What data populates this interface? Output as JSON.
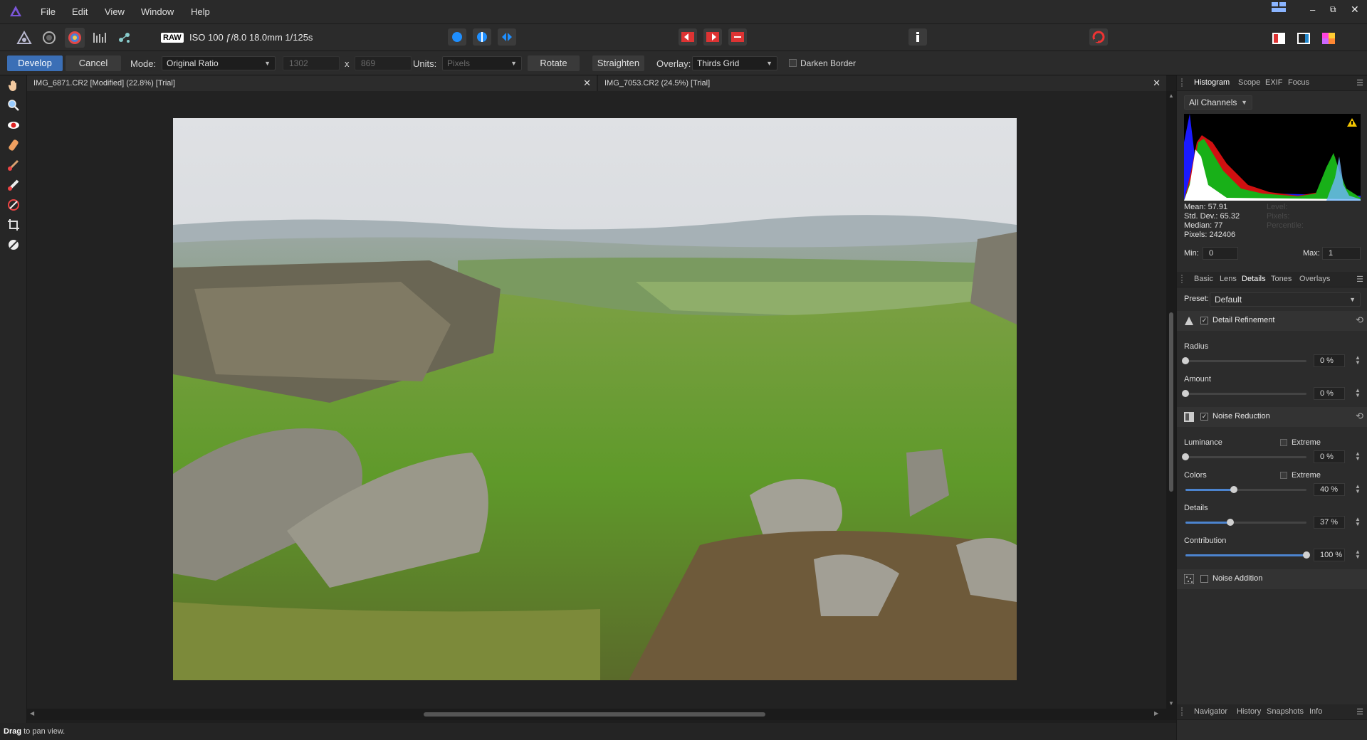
{
  "menubar": {
    "items": [
      "File",
      "Edit",
      "View",
      "Window",
      "Help"
    ]
  },
  "toolbar": {
    "raw_badge": "RAW",
    "exif_summary": "ISO 100 ƒ/8.0 18.0mm 1/125s"
  },
  "context": {
    "develop": "Develop",
    "cancel": "Cancel",
    "mode_label": "Mode:",
    "mode_value": "Original Ratio",
    "width_value": "1302",
    "x_sep": "x",
    "height_value": "869",
    "units_label": "Units:",
    "units_value": "Pixels",
    "rotate": "Rotate",
    "straighten": "Straighten",
    "overlay_label": "Overlay:",
    "overlay_value": "Thirds Grid",
    "darken_border": "Darken Border"
  },
  "doc_tabs": [
    {
      "title": "IMG_6871.CR2 [Modified] (22.8%) [Trial]",
      "active": true
    },
    {
      "title": "IMG_7053.CR2 (24.5%) [Trial]",
      "active": false
    }
  ],
  "status": {
    "bold": "Drag",
    "text": " to pan view."
  },
  "histogram_panel": {
    "tabs": [
      "Histogram",
      "Scope",
      "EXIF",
      "Focus"
    ],
    "channel": "All Channels",
    "stats": {
      "mean": "Mean: 57.91",
      "stddev": "Std. Dev.: 65.32",
      "median": "Median: 77",
      "pixels": "Pixels: 242406"
    },
    "stats_dim": [
      "Level:",
      "Pixels:",
      "Percentile:"
    ],
    "min_label": "Min:",
    "min_value": "0",
    "max_label": "Max:",
    "max_value": "1"
  },
  "details_panel": {
    "tabs": [
      "Basic",
      "Lens",
      "Details",
      "Tones",
      "Overlays"
    ],
    "preset_label": "Preset:",
    "preset_value": "Default",
    "detail_refinement": {
      "title": "Detail Refinement",
      "radius": {
        "label": "Radius",
        "value": "0 %",
        "level": 0
      },
      "amount": {
        "label": "Amount",
        "value": "0 %",
        "level": 0
      }
    },
    "noise_reduction": {
      "title": "Noise Reduction",
      "luminance": {
        "label": "Luminance",
        "value": "0 %",
        "level": 0,
        "extreme": "Extreme"
      },
      "colors": {
        "label": "Colors",
        "value": "40 %",
        "level": 0.4,
        "extreme": "Extreme"
      },
      "details": {
        "label": "Details",
        "value": "37 %",
        "level": 0.37
      },
      "contribution": {
        "label": "Contribution",
        "value": "100 %",
        "level": 1.0
      }
    },
    "noise_addition": {
      "title": "Noise Addition"
    }
  },
  "bottom_panel": {
    "tabs": [
      "Navigator",
      "History",
      "Snapshots",
      "Info"
    ]
  },
  "colors": {
    "accent": "#3b6fb6",
    "slider": "#4c84cf"
  }
}
